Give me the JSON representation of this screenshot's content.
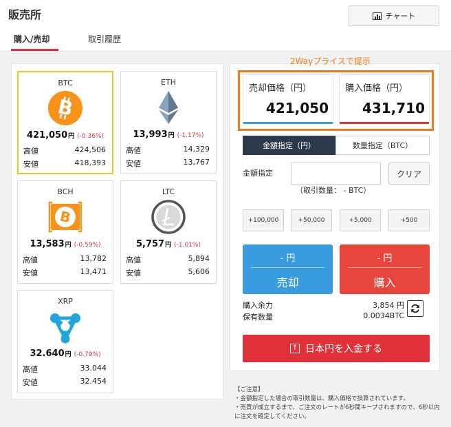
{
  "header": {
    "title": "販売所",
    "chart_button_label": "チャート"
  },
  "tabs": [
    {
      "label": "購入/売却",
      "active": true
    },
    {
      "label": "取引履歴",
      "active": false
    }
  ],
  "coins": [
    {
      "name": "BTC",
      "price": "421,050",
      "unit": "円",
      "change": "(-0.36%)",
      "high_label": "高値",
      "high": "424,506",
      "low_label": "安値",
      "low": "418,393",
      "selected": true,
      "icon": "bitcoin-icon",
      "color": "#f7931a"
    },
    {
      "name": "ETH",
      "price": "13,993",
      "unit": "円",
      "change": "(-1.17%)",
      "high_label": "高値",
      "high": "14,329",
      "low_label": "安値",
      "low": "13,767",
      "selected": false,
      "icon": "ethereum-icon",
      "color": "#6f8aa6"
    },
    {
      "name": "BCH",
      "price": "13,583",
      "unit": "円",
      "change": "(-0.59%)",
      "high_label": "高値",
      "high": "13,782",
      "low_label": "安値",
      "low": "13,471",
      "selected": false,
      "icon": "bitcoin-cash-icon",
      "color": "#f7931a"
    },
    {
      "name": "LTC",
      "price": "5,757",
      "unit": "円",
      "change": "(-1.01%)",
      "high_label": "高値",
      "high": "5,894",
      "low_label": "安値",
      "low": "5,606",
      "selected": false,
      "icon": "litecoin-icon",
      "color": "#777777"
    },
    {
      "name": "XRP",
      "price": "32.640",
      "unit": "円",
      "change": "(-0.79%)",
      "high_label": "高値",
      "high": "33.044",
      "low_label": "安値",
      "low": "32.454",
      "selected": false,
      "icon": "ripple-icon",
      "color": "#23a4dc"
    }
  ],
  "annotation": "2Wayプライスで提示",
  "prices": {
    "sell_label": "売却価格（円）",
    "sell_value": "421,050",
    "buy_label": "購入価格（円）",
    "buy_value": "431,710"
  },
  "order_mode": {
    "amount_tab": "金額指定（円）",
    "qty_tab": "数量指定（BTC）",
    "active": "amount"
  },
  "amount": {
    "label": "金額指定",
    "value": "",
    "clear_label": "クリア",
    "qty_text": "（取引数量： - BTC）"
  },
  "add_buttons": [
    "+100,000",
    "+50,000",
    "+5,000",
    "+500"
  ],
  "trade": {
    "sell_top": "- 円",
    "sell_label": "売却",
    "buy_top": "- 円",
    "buy_label": "購入"
  },
  "balance": {
    "buying_power_label": "購入余力",
    "buying_power": "3,854 円",
    "holding_label": "保有数量",
    "holding": "0.0034BTC"
  },
  "deposit_label": "日本円を入金する",
  "notes": {
    "title": "【ご注意】",
    "line1": "・金額指定した場合の取引数量は、購入価格で換算されています。",
    "line2": "・売買が成立するまで、ご注文のレートが6秒間キープされますので、6秒以内に注文を確定してください。"
  },
  "colors": {
    "accent_red": "#e0303a",
    "sell_blue": "#3a9ce0",
    "highlight_orange": "#f07b1c",
    "selected_gold": "#f5c326"
  }
}
